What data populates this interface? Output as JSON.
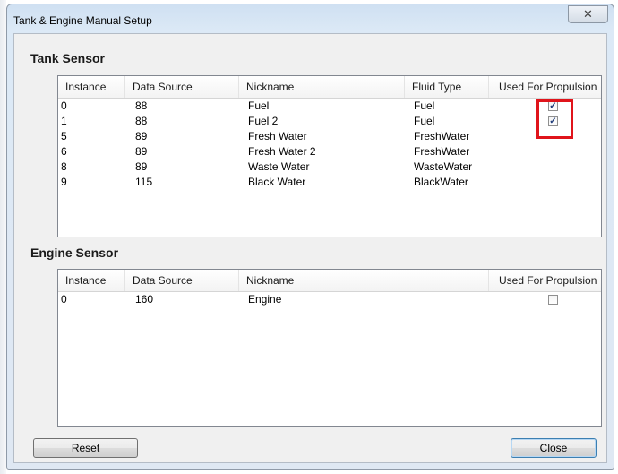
{
  "window": {
    "title": "Tank & Engine Manual Setup",
    "close_glyph": "✕"
  },
  "tank": {
    "title": "Tank Sensor",
    "columns": [
      "Instance",
      "Data Source",
      "Nickname",
      "Fluid Type",
      "Used For Propulsion"
    ],
    "rows": [
      {
        "instance": "0",
        "source": "88",
        "nickname": "Fuel",
        "fluid": "Fuel",
        "propulsion": true
      },
      {
        "instance": "1",
        "source": "88",
        "nickname": "Fuel 2",
        "fluid": "Fuel",
        "propulsion": true
      },
      {
        "instance": "5",
        "source": "89",
        "nickname": "Fresh Water",
        "fluid": "FreshWater",
        "propulsion": null
      },
      {
        "instance": "6",
        "source": "89",
        "nickname": "Fresh Water 2",
        "fluid": "FreshWater",
        "propulsion": null
      },
      {
        "instance": "8",
        "source": "89",
        "nickname": "Waste Water",
        "fluid": "WasteWater",
        "propulsion": null
      },
      {
        "instance": "9",
        "source": "115",
        "nickname": "Black Water",
        "fluid": "BlackWater",
        "propulsion": null
      }
    ]
  },
  "engine": {
    "title": "Engine Sensor",
    "columns": [
      "Instance",
      "Data Source",
      "Nickname",
      "Used For Propulsion"
    ],
    "rows": [
      {
        "instance": "0",
        "source": "160",
        "nickname": "Engine",
        "propulsion": false
      }
    ]
  },
  "buttons": {
    "reset": "Reset",
    "close": "Close"
  },
  "colors": {
    "highlight": "#e0141b",
    "check": "#1f3c7a"
  }
}
